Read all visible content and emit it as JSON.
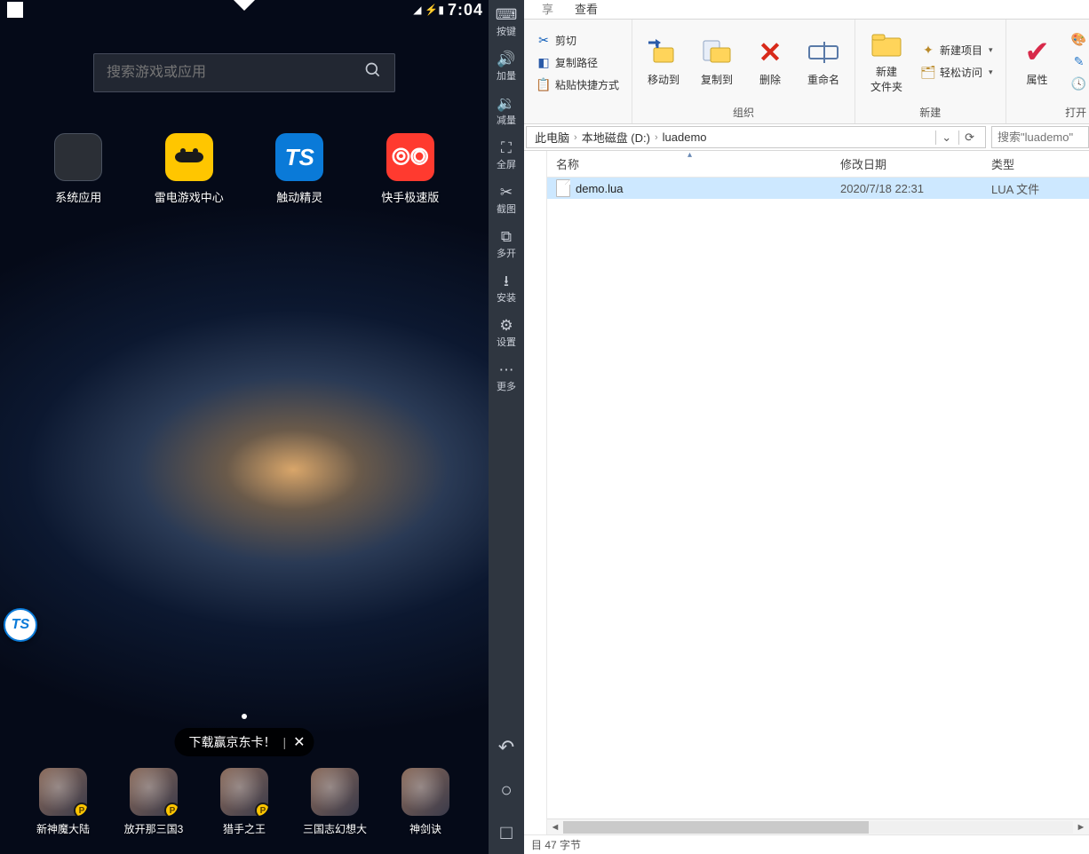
{
  "emulator": {
    "time": "7:04",
    "search_placeholder": "搜索游戏或应用",
    "apps_row1": [
      {
        "name": "系统应用"
      },
      {
        "name": "雷电游戏中心"
      },
      {
        "name": "触动精灵"
      },
      {
        "name": "快手极速版"
      }
    ],
    "toast": "下载赢京东卡！",
    "dock": [
      {
        "name": "新神魔大陆"
      },
      {
        "name": "放开那三国3"
      },
      {
        "name": "猎手之王"
      },
      {
        "name": "三国志幻想大"
      },
      {
        "name": "神剑诀"
      }
    ]
  },
  "sidebar": [
    {
      "icon": "⌨",
      "label": "按键"
    },
    {
      "icon": "🔊",
      "label": "加量"
    },
    {
      "icon": "🔉",
      "label": "减量"
    },
    {
      "icon": "⛶",
      "label": "全屏"
    },
    {
      "icon": "✂",
      "label": "截图"
    },
    {
      "icon": "⧉",
      "label": "多开"
    },
    {
      "icon": "⭳",
      "label": "安装"
    },
    {
      "icon": "⚙",
      "label": "设置"
    },
    {
      "icon": "⋯",
      "label": "更多"
    }
  ],
  "explorer": {
    "tab_view": "查看",
    "ribbon": {
      "clipboard": {
        "cut": "剪切",
        "copypath": "复制路径",
        "pasteshort": "粘贴快捷方式"
      },
      "organize": {
        "moveto": "移动到",
        "copyto": "复制到",
        "delete": "删除",
        "rename": "重命名",
        "name": "组织"
      },
      "new": {
        "newfolder": "新建\n文件夹",
        "newitem": "新建项目",
        "easyaccess": "轻松访问",
        "name": "新建"
      },
      "open": {
        "properties": "属性",
        "open": "打开",
        "edit": "编辑",
        "history": "历史记录",
        "name": "打开"
      }
    },
    "breadcrumb": [
      "此电脑",
      "本地磁盘 (D:)",
      "luademo"
    ],
    "search_placeholder": "搜索\"luademo\"",
    "columns": {
      "name": "名称",
      "date": "修改日期",
      "type": "类型"
    },
    "files": [
      {
        "name": "demo.lua",
        "date": "2020/7/18 22:31",
        "type": "LUA 文件"
      }
    ],
    "status": "目    47 字节"
  }
}
